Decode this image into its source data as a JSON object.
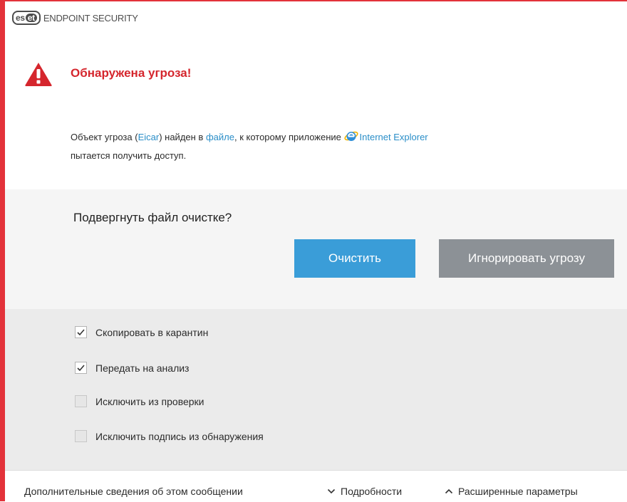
{
  "window": {
    "brand_badge_left": "es",
    "brand_badge_right": "et",
    "product_name": "ENDPOINT SECURITY",
    "accent_color": "#e3323a"
  },
  "alert": {
    "title": "Обнаружена угроза!",
    "icon": "warning-triangle-icon",
    "message_part1": "Объект угроза (",
    "threat_name": "Eicar",
    "message_part2": ") найден в ",
    "file_link": "файле",
    "message_part3": ", к которому приложение ",
    "app_icon": "internet-explorer-icon",
    "app_name": "Internet Explorer",
    "message_part4": "пытается получить доступ."
  },
  "prompt": {
    "question": "Подвергнуть файл очистке?",
    "clean_button": "Очистить",
    "ignore_button": "Игнорировать угрозу"
  },
  "options": [
    {
      "label": "Скопировать в карантин",
      "checked": true
    },
    {
      "label": "Передать на анализ",
      "checked": true
    },
    {
      "label": "Исключить из проверки",
      "checked": false
    },
    {
      "label": "Исключить подпись из обнаружения",
      "checked": false
    }
  ],
  "footer": {
    "more_info": "Дополнительные сведения об этом сообщении",
    "details": "Подробности",
    "advanced": "Расширенные параметры"
  }
}
